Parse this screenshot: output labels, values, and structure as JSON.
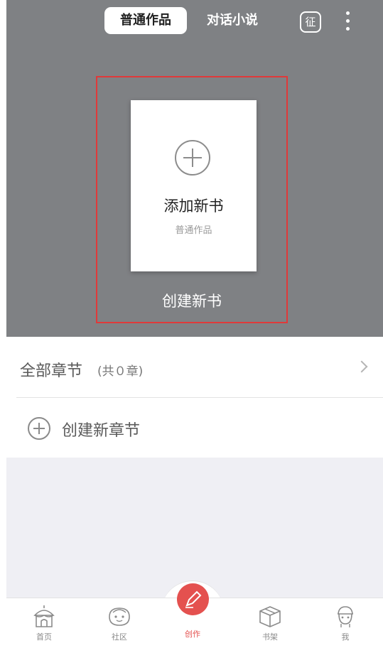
{
  "header": {
    "tabs": [
      {
        "label": "普通作品",
        "active": true
      },
      {
        "label": "对话小说",
        "active": false
      }
    ],
    "zheng_label": "征"
  },
  "book_card": {
    "title": "添加新书",
    "subtitle": "普通作品",
    "create_label": "创建新书"
  },
  "chapters": {
    "label": "全部章节",
    "count": "(共０章)",
    "new_chapter_label": "创建新章节"
  },
  "nav": {
    "items": [
      {
        "label": "首页",
        "icon": "home-icon"
      },
      {
        "label": "社区",
        "icon": "community-icon"
      },
      {
        "label": "创作",
        "icon": "create-icon",
        "active": true
      },
      {
        "label": "书架",
        "icon": "bookshelf-icon"
      },
      {
        "label": "我",
        "icon": "profile-icon"
      }
    ]
  },
  "colors": {
    "accent": "#e4514f",
    "header_bg": "#7f8184",
    "highlight_border": "#e0393a"
  }
}
